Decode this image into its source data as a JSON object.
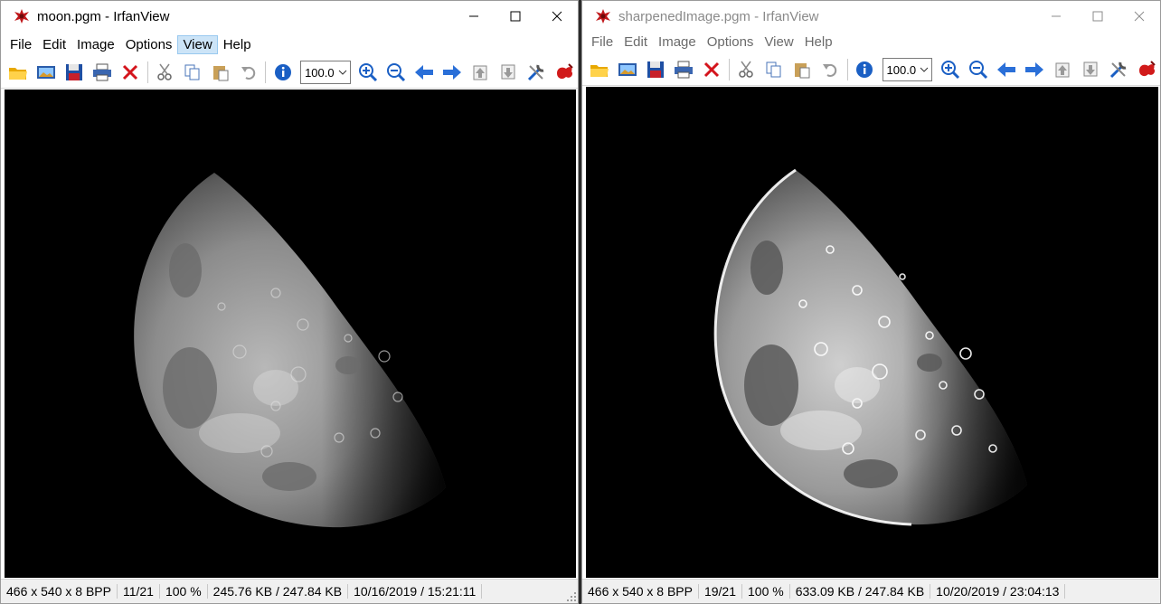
{
  "windows": [
    {
      "title": "moon.pgm - IrfanView",
      "menu": [
        "File",
        "Edit",
        "Image",
        "Options",
        "View",
        "Help"
      ],
      "active_menu": "View",
      "zoom_value": "100.0",
      "status": [
        "466 x 540 x 8 BPP",
        "11/21",
        "100 %",
        "245.76 KB / 247.84 KB",
        "10/16/2019 / 15:21:11"
      ],
      "image": "original-moon"
    },
    {
      "title": "sharpenedImage.pgm - IrfanView",
      "menu": [
        "File",
        "Edit",
        "Image",
        "Options",
        "View",
        "Help"
      ],
      "zoom_value": "100.0",
      "status": [
        "466 x 540 x 8 BPP",
        "19/21",
        "100 %",
        "633.09 KB / 247.84 KB",
        "10/20/2019 / 23:04:13"
      ],
      "image": "sharpened-moon"
    }
  ],
  "toolbar_icons": [
    "open-folder-icon",
    "slideshow-icon",
    "save-icon",
    "print-icon",
    "delete-icon",
    "cut-icon",
    "copy-icon",
    "paste-icon",
    "undo-icon",
    "info-icon",
    "zoom-dropdown",
    "zoom-in-icon",
    "zoom-out-icon",
    "previous-icon",
    "next-icon",
    "first-icon",
    "last-icon",
    "settings-icon",
    "irfanview-logo-icon"
  ],
  "colors": {
    "menu_active_bg": "#cce4f7",
    "inactive_title_text": "#8a8a8a",
    "canvas_bg": "#000000"
  }
}
